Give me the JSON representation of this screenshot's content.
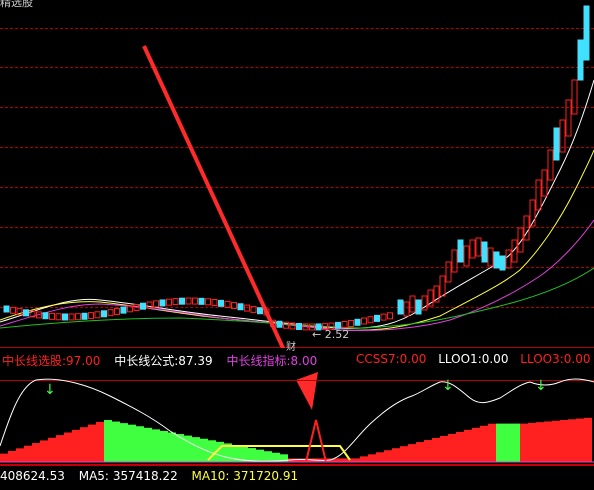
{
  "top_partial_text": "精选股",
  "price_low_label": "2.52",
  "price_low_prefix": "财",
  "indicator_legend": {
    "item1_label": "中长线选股:",
    "item1_value": "97.00",
    "item2_label": "中长线公式:",
    "item2_value": "87.39",
    "item3_label": "中长线指标:",
    "item3_value": "8.00",
    "item4_label": "CCSS7:",
    "item4_value": "0.00",
    "item5_label": "LLOO1:",
    "item5_value": "0.00",
    "item6_label": "LLOO3:",
    "item6_value": "0.00"
  },
  "volume_legend": {
    "vol_value": "408624.53",
    "ma5_label": "MA5:",
    "ma5_value": "357418.22",
    "ma10_label": "MA10:",
    "ma10_value": "371720.91"
  },
  "colors": {
    "red": "#ff2020",
    "cyan": "#40e0ff",
    "white": "#ffffff",
    "yellow": "#ffff40",
    "magenta": "#e040e0",
    "green": "#20c020",
    "grid": "#b30000",
    "lime": "#40ff40"
  }
}
